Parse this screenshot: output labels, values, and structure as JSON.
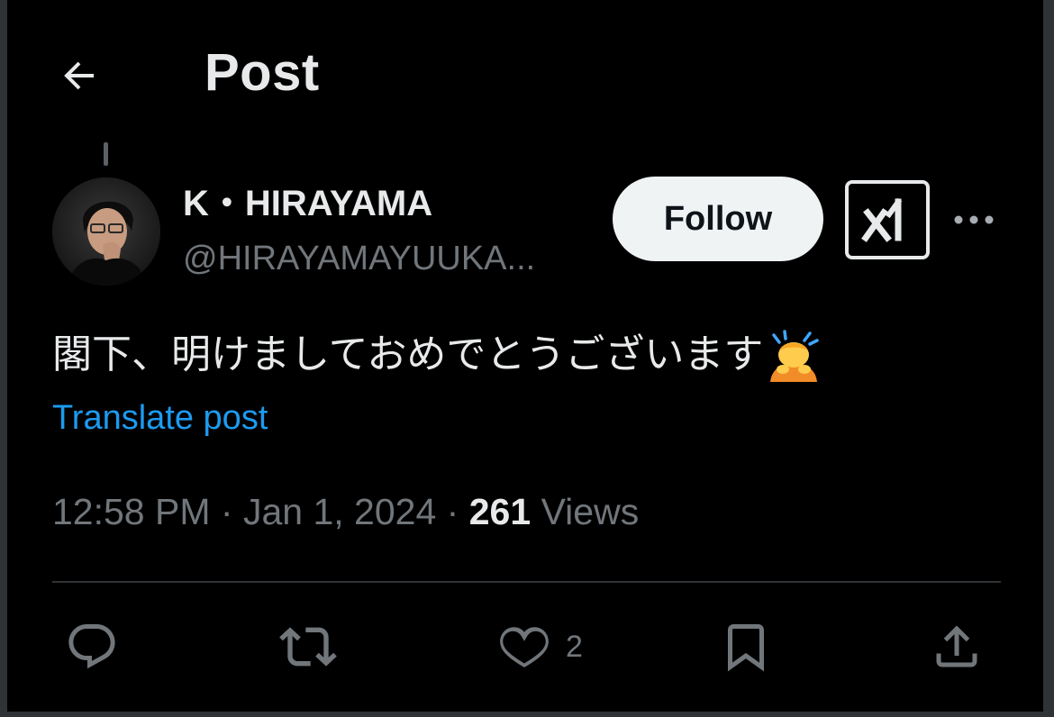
{
  "header": {
    "title": "Post",
    "back_icon": "arrow-left-icon"
  },
  "author": {
    "display_name": "K・HIRAYAMA",
    "handle": "@HIRAYAMAYUUKA...",
    "avatar": "avatar-photo"
  },
  "actions_top": {
    "follow_label": "Follow",
    "grok_icon": "grok-xai-icon",
    "more_icon": "more-dots-icon"
  },
  "post": {
    "text": "閣下、明けましておめでとうございます",
    "emoji": "person-bowing-emoji",
    "translate_label": "Translate post",
    "time": "12:58 PM",
    "date": "Jan 1, 2024",
    "views_count": "261",
    "views_label": "Views",
    "separator": "·"
  },
  "engagement": {
    "reply_icon": "reply-icon",
    "repost_icon": "repost-icon",
    "like_icon": "heart-icon",
    "like_count": "2",
    "bookmark_icon": "bookmark-icon",
    "share_icon": "share-icon"
  },
  "colors": {
    "background": "#000000",
    "text_primary": "#e7e9ea",
    "text_secondary": "#71767b",
    "link": "#1d9bf0",
    "divider": "#2f3336",
    "follow_bg": "#eff3f4"
  }
}
